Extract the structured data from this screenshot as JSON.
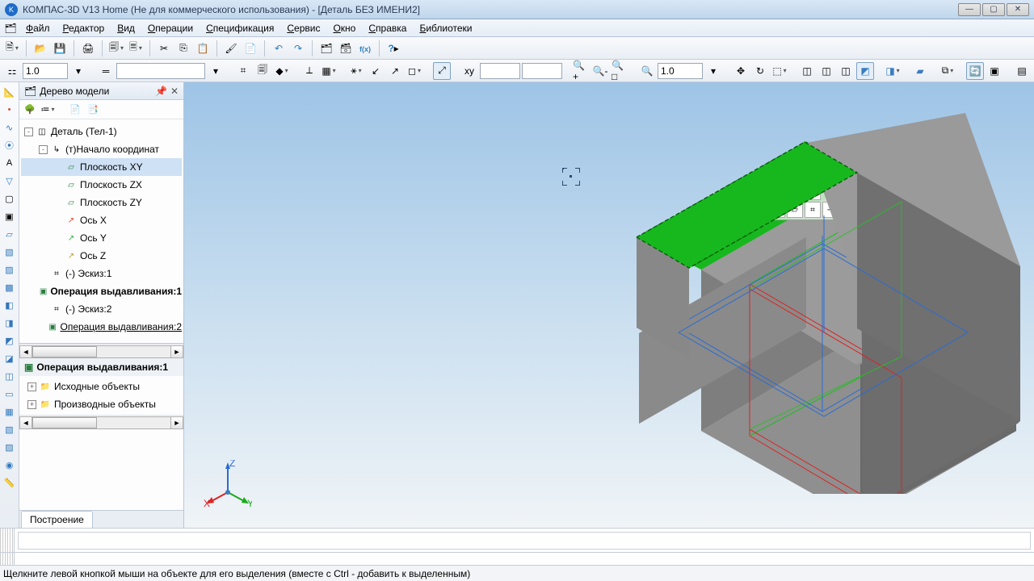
{
  "title": "КОМПАС-3D V13 Home (Не для коммерческого использования) - [Деталь БЕЗ ИМЕНИ2]",
  "menu": [
    "Файл",
    "Редактор",
    "Вид",
    "Операции",
    "Спецификация",
    "Сервис",
    "Окно",
    "Справка",
    "Библиотеки"
  ],
  "toolbar1": {
    "scale_input": "1.0"
  },
  "toolbar2": {
    "style_input": "",
    "coord_input": "",
    "zoom_input": "1.0"
  },
  "panel": {
    "title": "Дерево модели",
    "tree": [
      {
        "label": "Деталь (Тел-1)",
        "depth": 0,
        "expand": "-",
        "icon": "◫",
        "iconClass": "",
        "bold": false
      },
      {
        "label": "(т)Начало координат",
        "depth": 1,
        "expand": "-",
        "icon": "↳",
        "iconClass": "",
        "bold": false
      },
      {
        "label": "Плоскость XY",
        "depth": 2,
        "expand": "",
        "icon": "▱",
        "iconClass": "ico-plane",
        "bold": false,
        "selected": true
      },
      {
        "label": "Плоскость ZX",
        "depth": 2,
        "expand": "",
        "icon": "▱",
        "iconClass": "ico-plane",
        "bold": false
      },
      {
        "label": "Плоскость ZY",
        "depth": 2,
        "expand": "",
        "icon": "▱",
        "iconClass": "ico-plane",
        "bold": false
      },
      {
        "label": "Ось X",
        "depth": 2,
        "expand": "",
        "icon": "↗",
        "iconClass": "ico-axis-x",
        "bold": false
      },
      {
        "label": "Ось Y",
        "depth": 2,
        "expand": "",
        "icon": "↗",
        "iconClass": "ico-axis-y",
        "bold": false
      },
      {
        "label": "Ось Z",
        "depth": 2,
        "expand": "",
        "icon": "↗",
        "iconClass": "ico-axis-z",
        "bold": false
      },
      {
        "label": "(-) Эскиз:1",
        "depth": 1,
        "expand": "",
        "icon": "⌗",
        "iconClass": "",
        "bold": false
      },
      {
        "label": "Операция выдавливания:1",
        "depth": 1,
        "expand": "",
        "icon": "▣",
        "iconClass": "ico-cube",
        "bold": true
      },
      {
        "label": "(-) Эскиз:2",
        "depth": 1,
        "expand": "",
        "icon": "⌗",
        "iconClass": "",
        "bold": false
      },
      {
        "label": "Операция выдавливания:2",
        "depth": 1,
        "expand": "",
        "icon": "▣",
        "iconClass": "ico-cube",
        "bold": false,
        "underline": true
      }
    ],
    "sub_header": "Операция выдавливания:1",
    "sub_items": [
      {
        "label": "Исходные объекты",
        "icon": "📁",
        "expand": "+"
      },
      {
        "label": "Производные объекты",
        "icon": "📁",
        "expand": "+"
      }
    ],
    "tab": "Построение"
  },
  "axis": {
    "x": "X",
    "y": "Y",
    "z": "Z"
  },
  "status": "Щелкните левой кнопкой мыши на объекте для его выделения (вместе с Ctrl - добавить к выделенным)"
}
